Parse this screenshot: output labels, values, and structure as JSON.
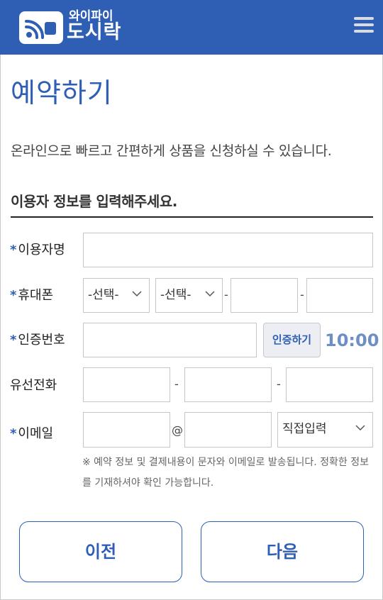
{
  "header": {
    "logo_small": "와이파이",
    "logo_big": "도시락",
    "menu_icon": "hamburger-icon"
  },
  "page": {
    "title": "예약하기",
    "description": "온라인으로 빠르고 간편하게 상품을 신청하실 수 있습니다.",
    "subheading": "이용자 정보를 입력해주세요."
  },
  "form": {
    "required_mark": "*",
    "name": {
      "label": "이용자명",
      "value": ""
    },
    "mobile": {
      "label": "휴대폰",
      "select1": "-선택-",
      "select2": "-선택-",
      "sep": "-"
    },
    "auth": {
      "label": "인증번호",
      "button": "인증하기",
      "timer": "10:00"
    },
    "phone": {
      "label": "유선전화",
      "sep": "-"
    },
    "email": {
      "label": "이메일",
      "at": "@",
      "domain_select": "직접입력"
    },
    "notice": "※ 예약 정보 및 결제내용이 문자와 이메일로 발송됩니다. 정확한 정보를 기재하셔야 확인 가능합니다."
  },
  "buttons": {
    "prev": "이전",
    "next": "다음"
  },
  "colors": {
    "brand": "#2f5fb4",
    "timer": "#6d8fc5"
  }
}
